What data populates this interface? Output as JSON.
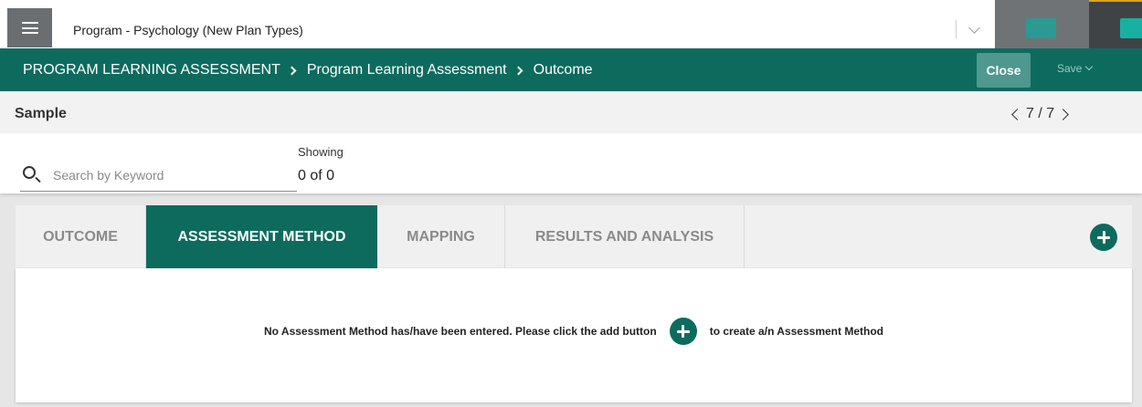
{
  "topbar": {
    "program_title": "Program - Psychology (New Plan Types)"
  },
  "breadcrumb": {
    "items": [
      "PROGRAM LEARNING ASSESSMENT",
      "Program Learning Assessment",
      "Outcome"
    ]
  },
  "actions": {
    "close_label": "Close",
    "save_label": "Save"
  },
  "record": {
    "title": "Sample",
    "pager": "7 / 7"
  },
  "filter": {
    "search_placeholder": "Search by Keyword",
    "showing_label": "Showing",
    "showing_value": "0 of 0"
  },
  "tabs": [
    {
      "label": "OUTCOME",
      "active": false
    },
    {
      "label": "ASSESSMENT METHOD",
      "active": true
    },
    {
      "label": "MAPPING",
      "active": false
    },
    {
      "label": "RESULTS AND ANALYSIS",
      "active": false
    }
  ],
  "empty_state": {
    "message_before": "No Assessment Method has/have been entered. Please click the add button",
    "message_after": "to create a/n Assessment Method"
  },
  "colors": {
    "brand_teal": "#0d6b5e",
    "close_button": "#4e9890",
    "topbar_gray": "#707376"
  },
  "icons": [
    "menu-icon",
    "chevron-down-icon",
    "chevron-right-icon",
    "chevron-left-icon",
    "search-icon",
    "add-circle-icon"
  ]
}
